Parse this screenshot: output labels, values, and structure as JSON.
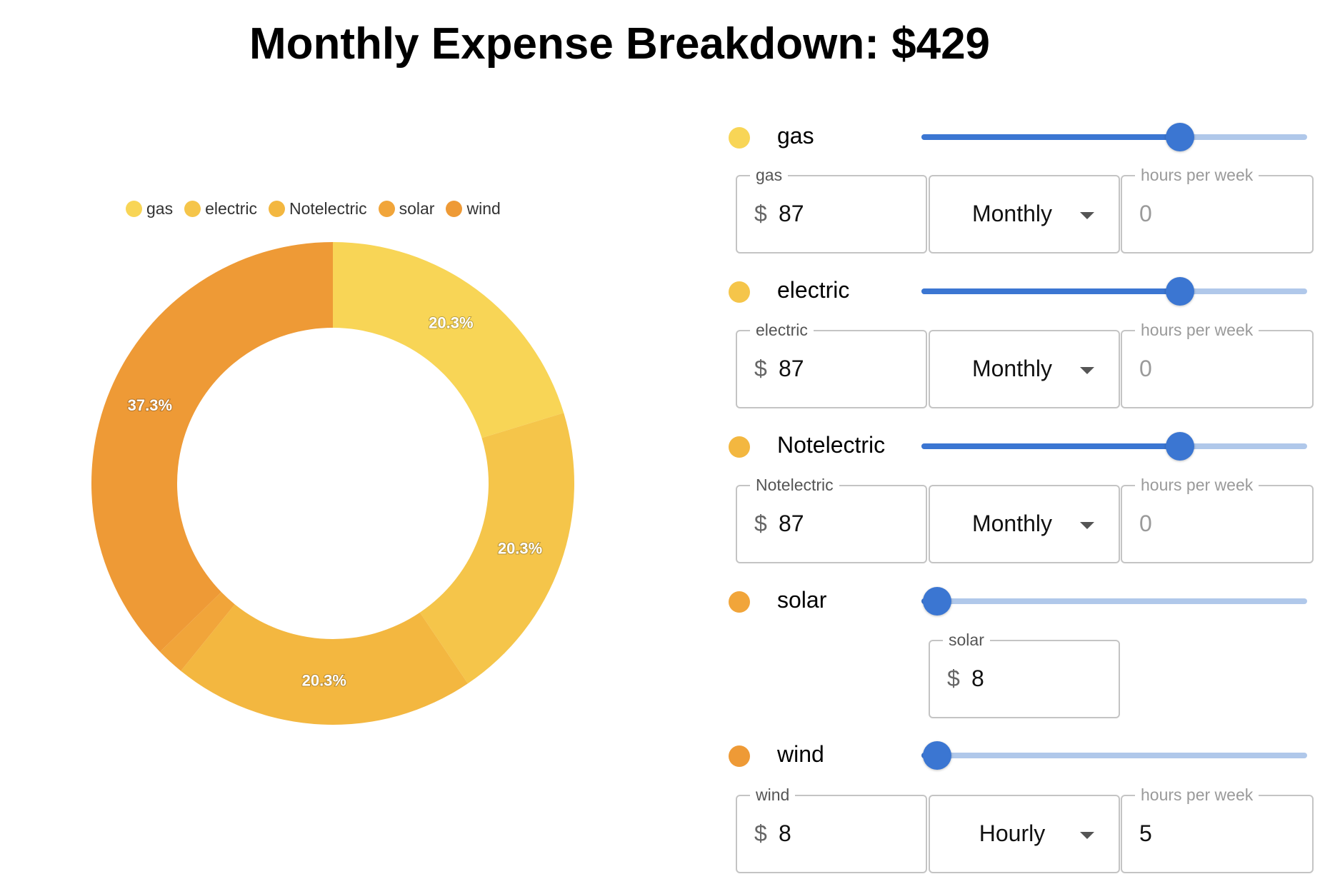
{
  "title": "Monthly Expense Breakdown: $429",
  "chart_data": {
    "type": "pie",
    "donut": true,
    "legend_position": "top",
    "categories": [
      "gas",
      "electric",
      "Notelectric",
      "solar",
      "wind"
    ],
    "values": [
      87,
      87,
      87,
      8,
      160
    ],
    "colors": [
      "#f8d556",
      "#f5c54a",
      "#f3b740",
      "#f1a53a",
      "#ee9a36"
    ],
    "slice_labels": [
      "20.3%",
      "20.3%",
      "20.3%",
      "",
      "37.3%"
    ]
  },
  "expenses": [
    {
      "name": "gas",
      "color": "#f8d556",
      "slider_fraction": 0.67,
      "field_label": "gas",
      "currency": "$",
      "amount": "87",
      "frequency": "Monthly",
      "hours_label": "hours per week",
      "hours": "0"
    },
    {
      "name": "electric",
      "color": "#f5c54a",
      "slider_fraction": 0.67,
      "field_label": "electric",
      "currency": "$",
      "amount": "87",
      "frequency": "Monthly",
      "hours_label": "hours per week",
      "hours": "0"
    },
    {
      "name": "Notelectric",
      "color": "#f3b740",
      "slider_fraction": 0.67,
      "field_label": "Notelectric",
      "currency": "$",
      "amount": "87",
      "frequency": "Monthly",
      "hours_label": "hours per week",
      "hours": "0"
    },
    {
      "name": "solar",
      "color": "#f1a53a",
      "slider_fraction": 0.04,
      "field_label": "solar",
      "currency": "$",
      "amount": "8"
    },
    {
      "name": "wind",
      "color": "#ee9a36",
      "slider_fraction": 0.04,
      "field_label": "wind",
      "currency": "$",
      "amount": "8",
      "frequency": "Hourly",
      "hours_label": "hours per week",
      "hours": "5"
    }
  ]
}
